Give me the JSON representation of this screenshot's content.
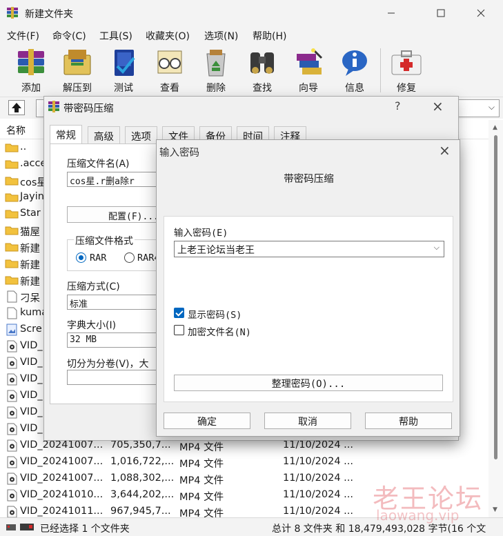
{
  "window": {
    "title": "新建文件夹"
  },
  "menu": [
    "文件(F)",
    "命令(C)",
    "工具(S)",
    "收藏夹(O)",
    "选项(N)",
    "帮助(H)"
  ],
  "toolbar": [
    {
      "label": "添加",
      "icon": "rar-books-icon"
    },
    {
      "label": "解压到",
      "icon": "extract-folder-icon"
    },
    {
      "label": "测试",
      "icon": "test-book-icon"
    },
    {
      "label": "查看",
      "icon": "view-glasses-icon"
    },
    {
      "label": "删除",
      "icon": "recycle-bin-icon"
    },
    {
      "label": "查找",
      "icon": "binoculars-icon"
    },
    {
      "label": "向导",
      "icon": "wizard-icon"
    },
    {
      "label": "信息",
      "icon": "info-icon"
    },
    {
      "label": "修复",
      "icon": "first-aid-icon"
    }
  ],
  "list": {
    "header_name": "名称",
    "rows": [
      {
        "name": "..",
        "size": "",
        "type": "",
        "date": "",
        "icon": "folder-icon"
      },
      {
        "name": ".acce",
        "size": "",
        "type": "",
        "date": "",
        "icon": "folder-icon"
      },
      {
        "name": "cos星",
        "size": "",
        "type": "",
        "date": "",
        "icon": "folder-icon"
      },
      {
        "name": "Jayin",
        "size": "",
        "type": "",
        "date": "",
        "icon": "folder-icon"
      },
      {
        "name": "Star ",
        "size": "",
        "type": "",
        "date": "",
        "icon": "folder-icon"
      },
      {
        "name": "猫屋",
        "size": "",
        "type": "",
        "date": "",
        "icon": "folder-icon"
      },
      {
        "name": "新建",
        "size": "",
        "type": "",
        "date": "",
        "icon": "folder-icon"
      },
      {
        "name": "新建",
        "size": "",
        "type": "",
        "date": "",
        "icon": "folder-icon"
      },
      {
        "name": "新建",
        "size": "",
        "type": "",
        "date": "",
        "icon": "folder-icon"
      },
      {
        "name": "刁呆",
        "size": "",
        "type": "",
        "date": "",
        "icon": "document-icon"
      },
      {
        "name": "kuma",
        "size": "",
        "type": "",
        "date": "",
        "icon": "document-icon"
      },
      {
        "name": "Scre",
        "size": "",
        "type": "",
        "date": "",
        "icon": "image-file-icon"
      },
      {
        "name": "VID_",
        "size": "",
        "type": "",
        "date": "",
        "icon": "video-file-icon"
      },
      {
        "name": "VID_",
        "size": "",
        "type": "",
        "date": "",
        "icon": "video-file-icon"
      },
      {
        "name": "VID_",
        "size": "",
        "type": "",
        "date": "",
        "icon": "video-file-icon"
      },
      {
        "name": "VID_",
        "size": "",
        "type": "",
        "date": "",
        "icon": "video-file-icon"
      },
      {
        "name": "VID_",
        "size": "",
        "type": "",
        "date": "",
        "icon": "video-file-icon"
      },
      {
        "name": "VID_",
        "size": "",
        "type": "",
        "date": "",
        "icon": "video-file-icon"
      },
      {
        "name": "VID_20241007...",
        "size": "705,350,7...",
        "type": "MP4 文件",
        "date": "11/10/2024 ...",
        "icon": "video-file-icon"
      },
      {
        "name": "VID_20241007...",
        "size": "1,016,722,...",
        "type": "MP4 文件",
        "date": "11/10/2024 ...",
        "icon": "video-file-icon"
      },
      {
        "name": "VID_20241007...",
        "size": "1,088,302,...",
        "type": "MP4 文件",
        "date": "11/10/2024 ...",
        "icon": "video-file-icon"
      },
      {
        "name": "VID_20241010...",
        "size": "3,644,202,...",
        "type": "MP4 文件",
        "date": "11/10/2024 ...",
        "icon": "video-file-icon"
      },
      {
        "name": "VID_20241011...",
        "size": "967,945,7...",
        "type": "MP4 文件",
        "date": "11/10/2024 ...",
        "icon": "video-file-icon"
      }
    ]
  },
  "status": {
    "left": "已经选择 1 个文件夹",
    "right": "总计 8 文件夹 和 18,479,493,028 字节(16 个文"
  },
  "archive_dialog": {
    "title": "带密码压缩",
    "help": "?",
    "tabs": [
      "常规",
      "高级",
      "选项",
      "文件",
      "备份",
      "时间",
      "注释"
    ],
    "archive_name_label": "压缩文件名(A)",
    "archive_name_value": "cos星.r删a除r",
    "profiles_button": "配置(F)...",
    "format_group": "压缩文件格式",
    "format_rar": "RAR",
    "format_rar4": "RAR4",
    "method_label": "压缩方式(C)",
    "method_value": "标准",
    "dict_label": "字典大小(I)",
    "dict_value": "32 MB",
    "split_label": "切分为分卷(V)，大"
  },
  "password_dialog": {
    "title": "输入密码",
    "heading": "带密码压缩",
    "enter_label": "输入密码(E)",
    "password_value": "上老王论坛当老王",
    "show_password": "显示密码(S)",
    "show_password_checked": true,
    "encrypt_names": "加密文件名(N)",
    "encrypt_names_checked": false,
    "organize_button": "整理密码(O)...",
    "ok": "确定",
    "cancel": "取消",
    "help": "帮助"
  },
  "watermark": {
    "cn": "老王论坛",
    "url": "laowang.vip"
  }
}
